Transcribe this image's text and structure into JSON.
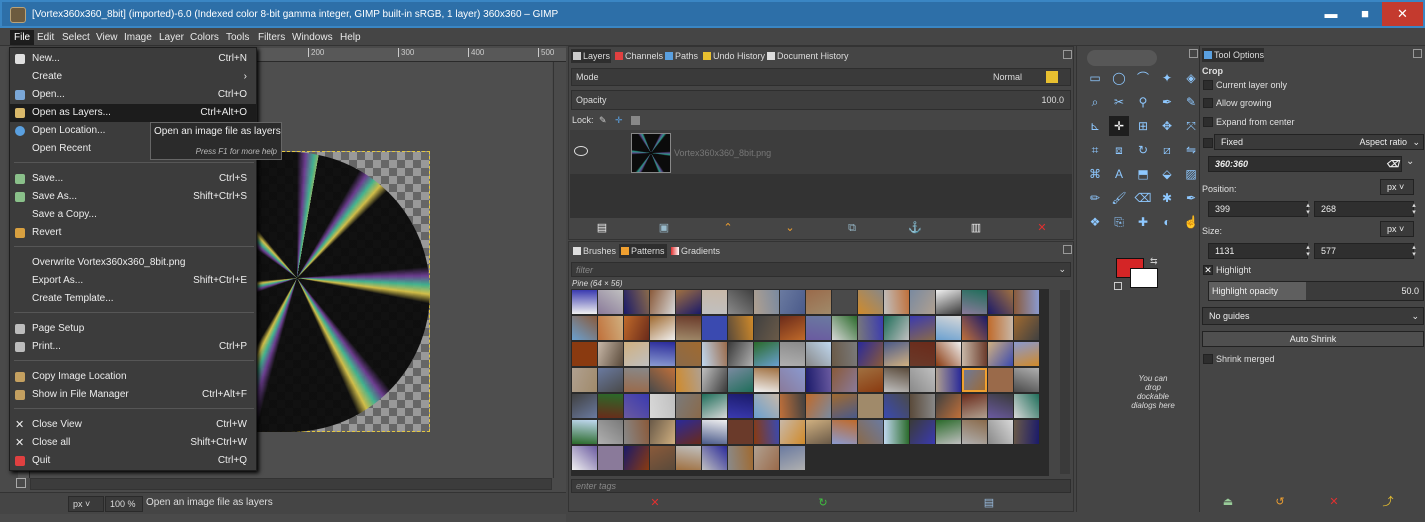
{
  "window": {
    "title": "[Vortex360x360_8bit] (imported)-6.0 (Indexed color 8-bit gamma integer, GIMP built-in sRGB, 1 layer) 360x360 – GIMP",
    "minimize": "▬",
    "maximize": "■",
    "close": "✕"
  },
  "menubar": [
    "File",
    "Edit",
    "Select",
    "View",
    "Image",
    "Layer",
    "Colors",
    "Tools",
    "Filters",
    "Windows",
    "Help"
  ],
  "file_menu": [
    {
      "label": "New...",
      "shortcut": "Ctrl+N",
      "icon_color": "#e0e0e0"
    },
    {
      "label": "Create",
      "shortcut": "›",
      "icon_color": ""
    },
    {
      "label": "Open...",
      "shortcut": "Ctrl+O",
      "icon_color": "#7aa7d8"
    },
    {
      "label": "Open as Layers...",
      "shortcut": "Ctrl+Alt+O",
      "icon_color": "#d8b86a"
    },
    {
      "label": "Open Location...",
      "shortcut": "",
      "icon_color": "#5aa0e0"
    },
    {
      "label": "Open Recent",
      "shortcut": "",
      "icon_color": ""
    },
    {
      "label": "Save...",
      "shortcut": "Ctrl+S",
      "icon_color": "#8ac08a"
    },
    {
      "label": "Save As...",
      "shortcut": "Shift+Ctrl+S",
      "icon_color": "#8ac08a"
    },
    {
      "label": "Save a Copy...",
      "shortcut": "",
      "icon_color": ""
    },
    {
      "label": "Revert",
      "shortcut": "",
      "icon_color": "#d8a040"
    },
    {
      "label": "Overwrite Vortex360x360_8bit.png",
      "shortcut": "",
      "icon_color": ""
    },
    {
      "label": "Export As...",
      "shortcut": "Shift+Ctrl+E",
      "icon_color": ""
    },
    {
      "label": "Create Template...",
      "shortcut": "",
      "icon_color": ""
    },
    {
      "label": "Page Setup",
      "shortcut": "",
      "icon_color": "#bcbcbc"
    },
    {
      "label": "Print...",
      "shortcut": "Ctrl+P",
      "icon_color": "#bcbcbc"
    },
    {
      "label": "Copy Image Location",
      "shortcut": "",
      "icon_color": "#c4a060"
    },
    {
      "label": "Show in File Manager",
      "shortcut": "Ctrl+Alt+F",
      "icon_color": "#c4a060"
    },
    {
      "label": "Close View",
      "shortcut": "Ctrl+W",
      "icon_color": "#e0e0e0"
    },
    {
      "label": "Close all",
      "shortcut": "Shift+Ctrl+W",
      "icon_color": "#e0e0e0"
    },
    {
      "label": "Quit",
      "shortcut": "Ctrl+Q",
      "icon_color": "#e04040"
    }
  ],
  "tooltip": {
    "text": "Open an image file as layers",
    "help": "Press F1 for more help"
  },
  "ruler": {
    "ticks": [
      "200",
      "300",
      "400",
      "500"
    ]
  },
  "status": {
    "unit": "px",
    "zoom": "100 %",
    "message": "Open an image file as layers"
  },
  "layers_dock": {
    "tabs": [
      "Layers",
      "Channels",
      "Paths",
      "Undo History",
      "Document History"
    ],
    "mode_label": "Mode",
    "mode_value": "Normal",
    "opacity_label": "Opacity",
    "opacity_value": "100.0",
    "lock_label": "Lock:",
    "layer_name": "Vortex360x360_8bit.png"
  },
  "brushes_dock": {
    "tabs": [
      "Brushes",
      "Patterns",
      "Gradients"
    ],
    "filter_placeholder": "filter",
    "pattern_name": "Pine (64 × 56)",
    "tags_placeholder": "enter tags"
  },
  "toolbox": {
    "drop_hint": "You can drop dockable dialogs here",
    "fg_color": "#d42526",
    "bg_color": "#ffffff"
  },
  "tool_options": {
    "tab": "Tool Options",
    "tool_name": "Crop",
    "current_layer_only": "Current layer only",
    "allow_growing": "Allow growing",
    "expand_from_center": "Expand from center",
    "fixed_label": "Fixed",
    "aspect_label": "Aspect ratio",
    "ratio_value": "360:360",
    "position_label": "Position:",
    "position_unit": "px",
    "pos_x": "399",
    "pos_y": "268",
    "size_label": "Size:",
    "size_unit": "px",
    "size_w": "1131",
    "size_h": "577",
    "highlight_label": "Highlight",
    "highlight_opacity_label": "Highlight opacity",
    "highlight_opacity_value": "50.0",
    "guides_value": "No guides",
    "auto_shrink": "Auto Shrink",
    "shrink_merged": "Shrink merged"
  }
}
